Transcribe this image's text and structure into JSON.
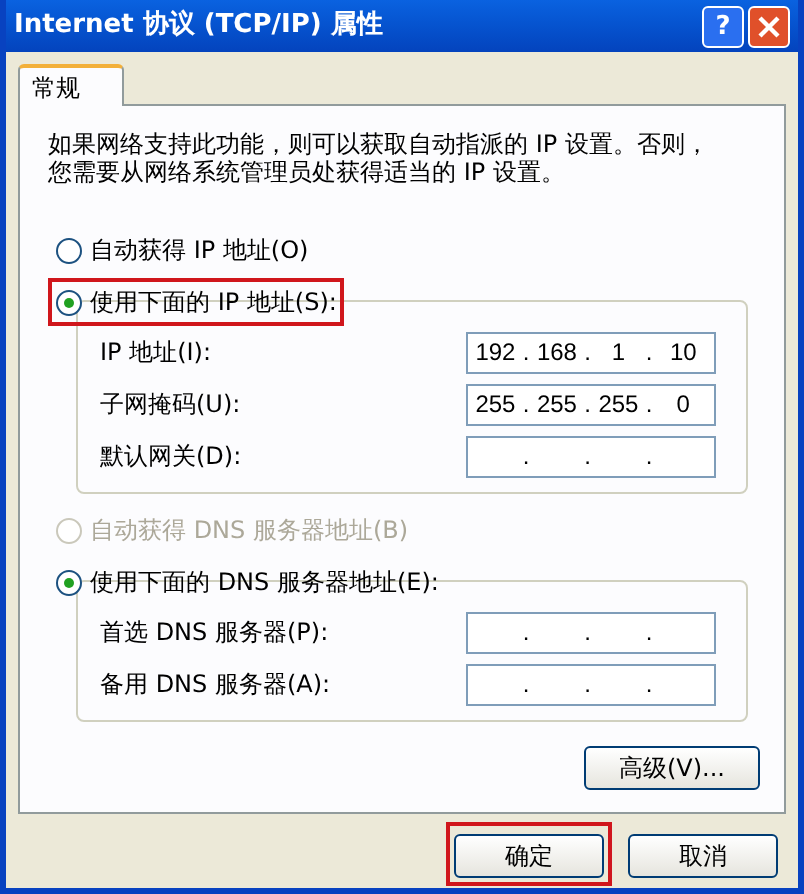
{
  "window": {
    "title": "Internet 协议 (TCP/IP) 属性",
    "help_button": "?"
  },
  "tabs": [
    {
      "label": "常规",
      "selected": true
    }
  ],
  "intro": "如果网络支持此功能，则可以获取自动指派的 IP 设置。否则，您需要从网络系统管理员处获得适当的 IP 设置。",
  "separator": ".",
  "ip_section": {
    "radios": [
      {
        "label": "自动获得 IP 地址(O)",
        "selected": false,
        "disabled": false,
        "highlighted": false
      },
      {
        "label": "使用下面的 IP 地址(S):",
        "selected": true,
        "disabled": false,
        "highlighted": true
      }
    ],
    "fields": [
      {
        "label": "IP 地址(I):",
        "octets": [
          "192",
          "168",
          "1",
          "10"
        ]
      },
      {
        "label": "子网掩码(U):",
        "octets": [
          "255",
          "255",
          "255",
          "0"
        ]
      },
      {
        "label": "默认网关(D):"
      }
    ]
  },
  "dns_section": {
    "radios": [
      {
        "label": "自动获得 DNS 服务器地址(B)",
        "selected": false,
        "disabled": true,
        "highlighted": false
      },
      {
        "label": "使用下面的 DNS 服务器地址(E):",
        "selected": true,
        "disabled": false,
        "highlighted": false
      }
    ],
    "fields": [
      {
        "label": "首选 DNS 服务器(P):"
      },
      {
        "label": "备用 DNS 服务器(A):"
      }
    ]
  },
  "advanced_button": "高级(V)...",
  "buttons": [
    {
      "label": "确定",
      "highlighted": true
    },
    {
      "label": "取消",
      "highlighted": false
    }
  ]
}
